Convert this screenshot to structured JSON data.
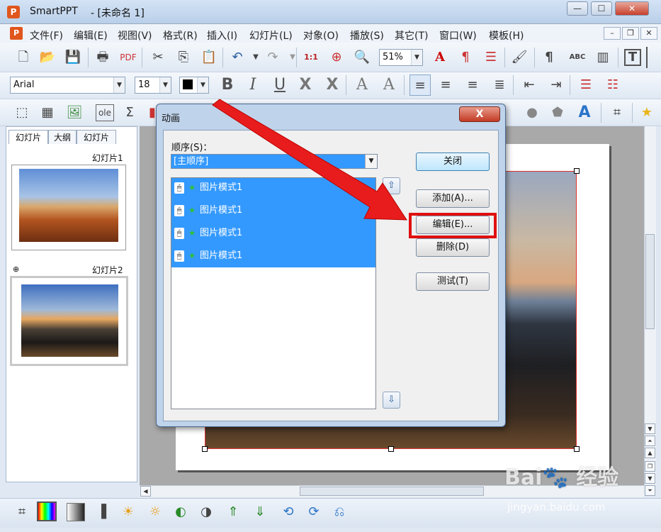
{
  "window": {
    "app_name": "SmartPPT",
    "doc_title": "- [未命名 1]",
    "app_icon": "P",
    "controls": {
      "minimize": "—",
      "maximize": "☐",
      "close": "✕"
    }
  },
  "menubar": {
    "icon": "P",
    "items": [
      "文件(F)",
      "编辑(E)",
      "视图(V)",
      "格式(R)",
      "插入(I)",
      "幻灯片(L)",
      "对象(O)",
      "播放(S)",
      "其它(T)",
      "窗口(W)",
      "模板(H)"
    ],
    "mdi_controls": {
      "minimize": "–",
      "restore": "❐",
      "close": "✕"
    }
  },
  "toolbar_standard": {
    "zoom": "51%",
    "icons": [
      "new-file-icon",
      "open-folder-icon",
      "save-icon",
      "print-icon",
      "pdf-icon",
      "cut-icon",
      "copy-icon",
      "paste-icon",
      "undo-icon",
      "redo-icon",
      "actual-size-icon",
      "zoom-target-icon",
      "zoom-icon",
      "text-color-icon",
      "paragraph-mark-icon",
      "list-icon",
      "brush-icon",
      "pilcrow-icon",
      "spellcheck-icon",
      "table-icon",
      "textbox-icon"
    ]
  },
  "toolbar_format": {
    "font": "Arial",
    "size": "18",
    "color": "#000000",
    "buttons": {
      "bold": "B",
      "italic": "I",
      "underline": "U",
      "shadow": "X",
      "strike": "X",
      "grow": "A",
      "shrink": "A"
    }
  },
  "toolbar_insert": {
    "ole_label": "ole",
    "sigma": "Σ",
    "wordart": "A"
  },
  "side_panel": {
    "tabs": [
      "幻灯片",
      "大纲",
      "幻灯片"
    ],
    "slides": [
      {
        "label": "幻灯片1",
        "selected": false
      },
      {
        "label": "幻灯片2",
        "selected": true,
        "marker": "⊕"
      }
    ]
  },
  "dialog": {
    "title": "动画",
    "close": "X",
    "order_label": "顺序(S)：",
    "order_value": "[主顺序]",
    "animations": [
      "图片模式1",
      "图片模式1",
      "图片模式1",
      "图片模式1"
    ],
    "move_up": "⇧",
    "move_down": "⇩",
    "buttons": {
      "close": "关闭",
      "add": "添加(A)...",
      "edit": "编辑(E)...",
      "delete": "删除(D)",
      "test": "测试(T)"
    }
  },
  "watermark": {
    "brand": "Bai🐾 经验",
    "url": "jingyan.baidu.com"
  },
  "colors": {
    "selection": "#3399ff",
    "highlight": "#e01010",
    "arrow": "#e81c1c"
  }
}
